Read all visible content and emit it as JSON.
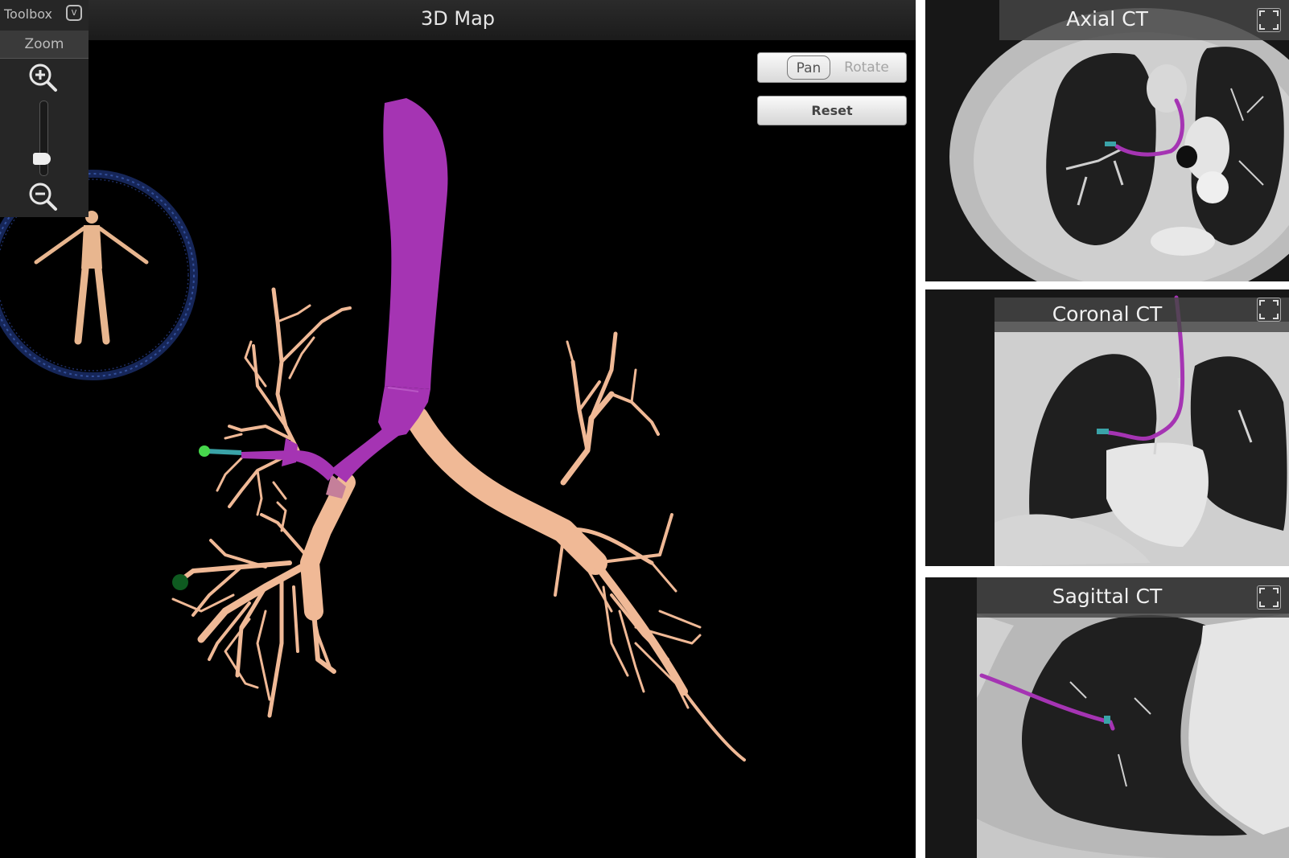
{
  "map": {
    "title": "3D Map",
    "toolbox": {
      "title": "Toolbox",
      "collapse_icon": "chevron-down-icon",
      "zoom_label": "Zoom",
      "zoom_in_icon": "zoom-in-icon",
      "zoom_out_icon": "zoom-out-icon",
      "zoom_level": 0.15
    },
    "view_mode": {
      "pan_label": "Pan",
      "rotate_label": "Rotate",
      "selected": "Pan"
    },
    "reset_label": "Reset",
    "colors": {
      "path": "#a534b3",
      "airway": "#f0b996",
      "target": "#3fd84f",
      "background": "#000000"
    }
  },
  "ct_views": [
    {
      "title": "Axial CT",
      "expand_icon": "expand-icon"
    },
    {
      "title": "Coronal CT",
      "expand_icon": "expand-icon"
    },
    {
      "title": "Sagittal CT",
      "expand_icon": "expand-icon"
    }
  ]
}
